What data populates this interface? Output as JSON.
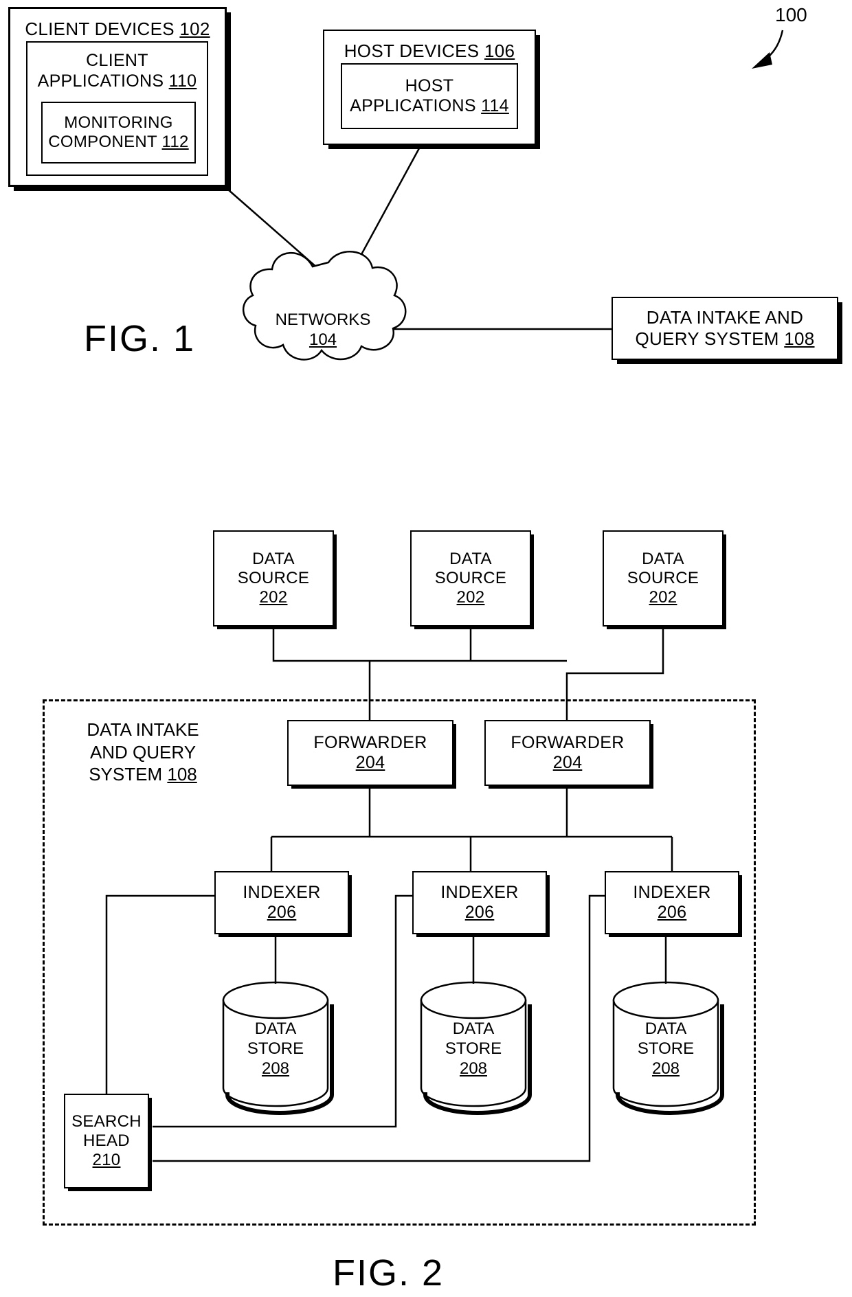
{
  "figure_1": {
    "label": "FIG. 1",
    "ref_numeral": "100",
    "client_devices": {
      "title": "CLIENT DEVICES",
      "number": "102",
      "client_applications": {
        "line1": "CLIENT",
        "line2": "APPLICATIONS",
        "number": "110",
        "monitoring_component": {
          "line1": "MONITORING",
          "line2": "COMPONENT",
          "number": "112"
        }
      }
    },
    "host_devices": {
      "title": "HOST DEVICES",
      "number": "106",
      "host_applications": {
        "line1": "HOST",
        "line2": "APPLICATIONS",
        "number": "114"
      }
    },
    "networks": {
      "title": "NETWORKS",
      "number": "104"
    },
    "data_intake_and_query_system": {
      "line1": "DATA INTAKE AND",
      "line2": "QUERY SYSTEM",
      "number": "108"
    }
  },
  "figure_2": {
    "label": "FIG. 2",
    "region": {
      "line1": "DATA INTAKE",
      "line2": "AND QUERY",
      "line3": "SYSTEM",
      "number": "108"
    },
    "data_sources": [
      {
        "line1": "DATA",
        "line2": "SOURCE",
        "number": "202"
      },
      {
        "line1": "DATA",
        "line2": "SOURCE",
        "number": "202"
      },
      {
        "line1": "DATA",
        "line2": "SOURCE",
        "number": "202"
      }
    ],
    "forwarders": [
      {
        "title": "FORWARDER",
        "number": "204"
      },
      {
        "title": "FORWARDER",
        "number": "204"
      }
    ],
    "indexers": [
      {
        "title": "INDEXER",
        "number": "206"
      },
      {
        "title": "INDEXER",
        "number": "206"
      },
      {
        "title": "INDEXER",
        "number": "206"
      }
    ],
    "data_stores": [
      {
        "line1": "DATA",
        "line2": "STORE",
        "number": "208"
      },
      {
        "line1": "DATA",
        "line2": "STORE",
        "number": "208"
      },
      {
        "line1": "DATA",
        "line2": "STORE",
        "number": "208"
      }
    ],
    "search_head": {
      "line1": "SEARCH",
      "line2": "HEAD",
      "number": "210"
    }
  },
  "colors": {
    "ink": "#000000",
    "paper": "#ffffff"
  }
}
